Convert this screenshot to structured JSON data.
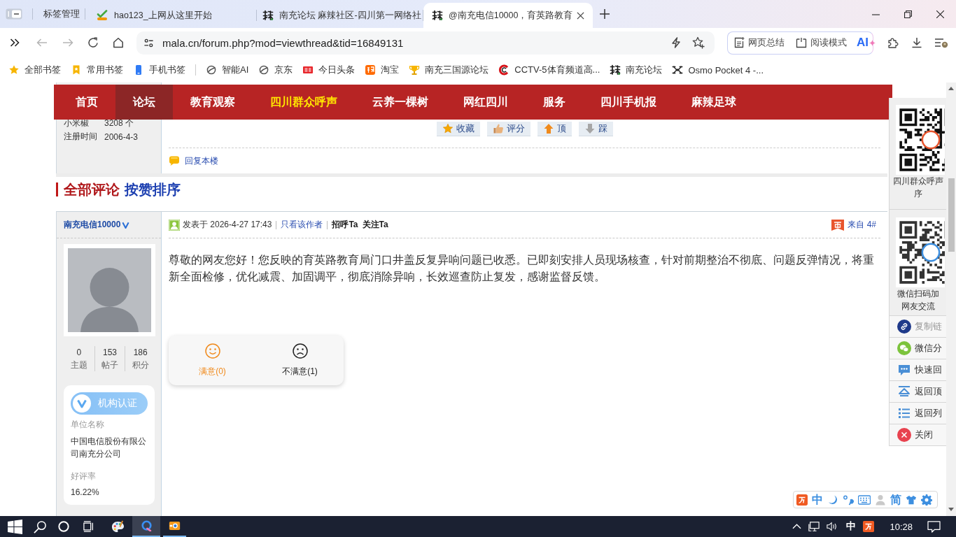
{
  "browser": {
    "tab_manager": "标签管理",
    "tabs": [
      {
        "title": "hao123_上网从这里开始",
        "selected": false
      },
      {
        "title": "南充论坛 麻辣社区-四川第一网络社",
        "selected": false
      },
      {
        "title": "@南充电信10000，育英路教育",
        "selected": true
      }
    ],
    "address": "mala.cn/forum.php?mod=viewthread&tid=16849131",
    "ai_tools": [
      "网页总结",
      "阅读模式"
    ],
    "ai_button": "AI",
    "bookmarks": [
      "全部书签",
      "常用书签",
      "手机书签",
      "智能AI",
      "京东",
      "今日头条",
      "淘宝",
      "南充三国源论坛",
      "CCTV-5体育频道高...",
      "南充论坛",
      "Osmo Pocket 4 -..."
    ]
  },
  "nav": [
    {
      "label": "首页",
      "selected": false,
      "highlighted": false
    },
    {
      "label": "论坛",
      "selected": true,
      "highlighted": false
    },
    {
      "label": "教育观察",
      "selected": false,
      "highlighted": false
    },
    {
      "label": "四川群众呼声",
      "selected": false,
      "highlighted": true
    },
    {
      "label": "云养一棵树",
      "selected": false,
      "highlighted": false
    },
    {
      "label": "网红四川",
      "selected": false,
      "highlighted": false
    },
    {
      "label": "服务",
      "selected": false,
      "highlighted": false
    },
    {
      "label": "四川手机报",
      "selected": false,
      "highlighted": false
    },
    {
      "label": "麻辣足球",
      "selected": false,
      "highlighted": false
    }
  ],
  "previous_post": {
    "stats": [
      {
        "label": "小米椒",
        "value": "3208 个"
      },
      {
        "label": "注册时间",
        "value": "2006-4-3"
      }
    ],
    "actions": [
      "收藏",
      "评分",
      "顶",
      "踩"
    ],
    "reply": "回复本楼"
  },
  "comments_heading": {
    "title": "全部评论",
    "sort": "按赞排序"
  },
  "post": {
    "author": "南充电信10000",
    "verified": true,
    "author_stats": [
      {
        "value": "0",
        "label": "主题"
      },
      {
        "value": "153",
        "label": "帖子"
      },
      {
        "value": "186",
        "label": "积分"
      }
    ],
    "certification": {
      "badge": "机构认证",
      "fields": [
        {
          "label": "单位名称",
          "value": "中国电信股份有限公司南充分公司"
        },
        {
          "label": "好评率",
          "value": "16.22%"
        }
      ]
    },
    "posted": "发表于 2026-4-27 17:43",
    "author_only": "只看该作者",
    "actions": [
      "招呼Ta",
      "关注Ta"
    ],
    "floor": "来自 4#",
    "body": "尊敬的网友您好！您反映的育英路教育局门口井盖反复异响问题已收悉。已即刻安排人员现场核查，针对前期整治不彻底、问题反弹情况，将重新全面检修，优化减震、加固调平，彻底消除异响，长效巡查防止复发，感谢监督反馈。",
    "ratings": [
      {
        "kind": "satisfied",
        "label": "满意(0)"
      },
      {
        "kind": "dissatisfied",
        "label": "不满意(1)"
      }
    ]
  },
  "side_panel": {
    "qr_codes": [
      {
        "caption": [
          "四川群众呼声",
          "序"
        ]
      },
      {
        "caption": [
          "微信扫码加",
          "网友交流"
        ]
      }
    ],
    "tools": [
      {
        "label": "复制链",
        "disabled": true
      },
      {
        "label": "微信分",
        "disabled": false
      },
      {
        "label": "快速回",
        "disabled": false
      },
      {
        "label": "返回顶",
        "disabled": false
      },
      {
        "label": "返回列",
        "disabled": false
      },
      {
        "label": "关闭",
        "disabled": false
      }
    ]
  },
  "ime_bar": {
    "mode": "中",
    "script": "简"
  },
  "taskbar": {
    "ime": "中",
    "time": "10:28"
  }
}
